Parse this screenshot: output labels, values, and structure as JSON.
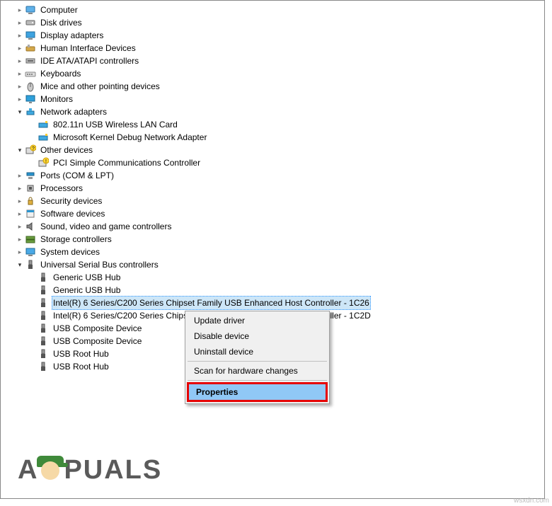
{
  "tree": {
    "computer": "Computer",
    "disk_drives": "Disk drives",
    "display_adapters": "Display adapters",
    "hid": "Human Interface Devices",
    "ide": "IDE ATA/ATAPI controllers",
    "keyboards": "Keyboards",
    "mice": "Mice and other pointing devices",
    "monitors": "Monitors",
    "network": "Network adapters",
    "net_child1": "802.11n USB Wireless LAN Card",
    "net_child2": "Microsoft Kernel Debug Network Adapter",
    "other": "Other devices",
    "other_child1": "PCI Simple Communications Controller",
    "ports": "Ports (COM & LPT)",
    "processors": "Processors",
    "security": "Security devices",
    "software": "Software devices",
    "sound": "Sound, video and game controllers",
    "storage": "Storage controllers",
    "system": "System devices",
    "usb": "Universal Serial Bus controllers",
    "usb_gen1": "Generic USB Hub",
    "usb_gen2": "Generic USB Hub",
    "usb_intel1": "Intel(R) 6 Series/C200 Series Chipset Family USB Enhanced Host Controller - 1C26",
    "usb_intel2": "Intel(R) 6 Series/C200 Series Chipset Family USB Enhanced Host Controller - 1C2D",
    "usb_comp1": "USB Composite Device",
    "usb_comp2": "USB Composite Device",
    "usb_root1": "USB Root Hub",
    "usb_root2": "USB Root Hub"
  },
  "menu": {
    "update": "Update driver",
    "disable": "Disable device",
    "uninstall": "Uninstall device",
    "scan": "Scan for hardware changes",
    "properties": "Properties"
  },
  "logo": {
    "left": "A",
    "right": "PUALS"
  },
  "watermark": "wsxdn.com"
}
